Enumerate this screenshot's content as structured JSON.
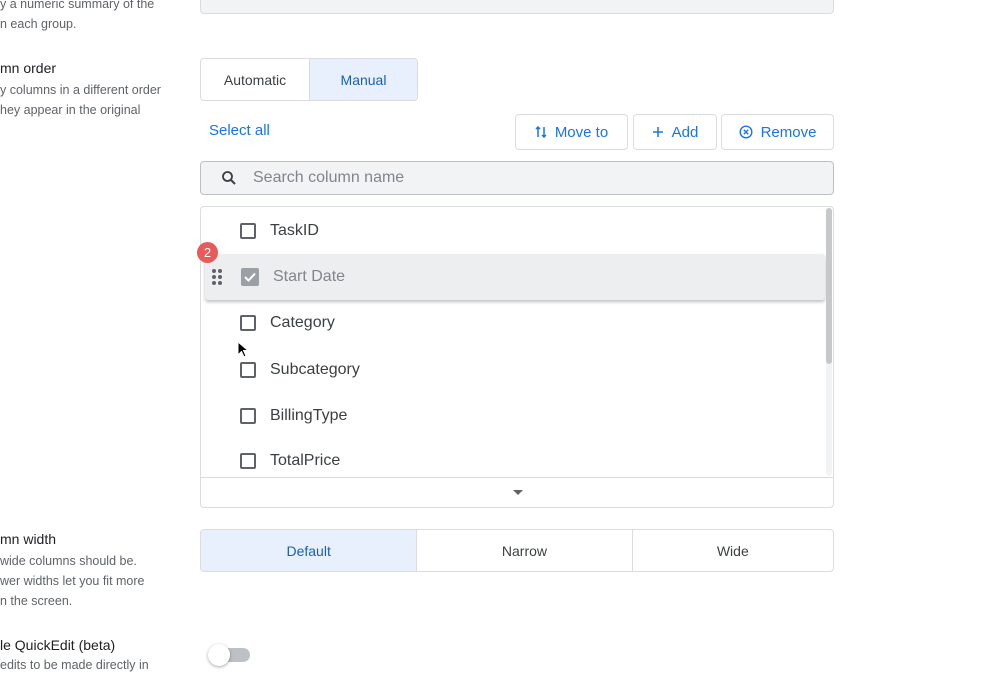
{
  "summary_section": {
    "desc_lines": [
      "y a numeric summary of the",
      "n each group."
    ]
  },
  "column_order": {
    "title": "mn order",
    "desc_lines": [
      "y columns in a different order",
      "hey appear in the original"
    ],
    "options": [
      "Automatic",
      "Manual"
    ],
    "selected": "Manual",
    "select_all_label": "Select all",
    "move_to_label": "Move to",
    "add_label": "Add",
    "remove_label": "Remove",
    "search_placeholder": "Search column name",
    "drag_count_badge": "2",
    "columns": [
      {
        "label": "TaskID",
        "checked": false
      },
      {
        "label": "Start Date",
        "checked": true,
        "dragging": true
      },
      {
        "label": "Category",
        "checked": false
      },
      {
        "label": "Subcategory",
        "checked": false
      },
      {
        "label": "BillingType",
        "checked": false
      },
      {
        "label": "TotalPrice",
        "checked": false
      }
    ]
  },
  "column_width": {
    "title": "mn width",
    "desc_lines": [
      "wide columns should be.",
      "wer widths let you fit more",
      "n the screen."
    ],
    "options": [
      "Default",
      "Narrow",
      "Wide"
    ],
    "selected": "Default"
  },
  "quickedit": {
    "title": "le QuickEdit (beta)",
    "desc_partial": "edits to be made directly in",
    "enabled": false
  },
  "colors": {
    "accent": "#1a73e8",
    "active_segment_bg": "#e8f0fe",
    "badge": "#e95b5b"
  }
}
